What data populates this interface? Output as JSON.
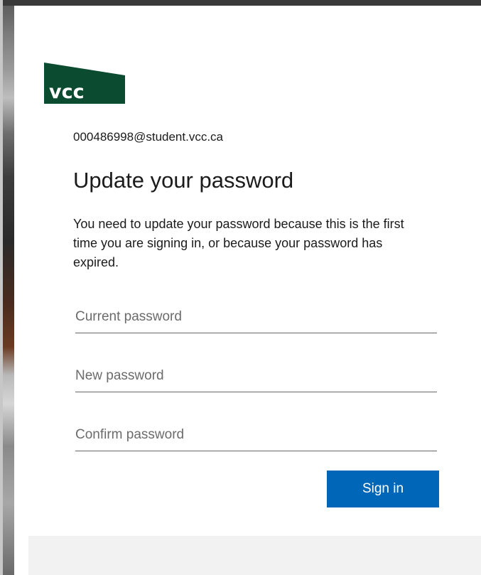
{
  "brand": {
    "logo_text": "vcc",
    "logo_color": "#0b4b30",
    "logo_text_color": "#ffffff"
  },
  "account": {
    "email": "000486998@student.vcc.ca"
  },
  "form": {
    "title": "Update your password",
    "description": "You need to update your password because this is the first time you are signing in, or because your password has expired.",
    "fields": {
      "current_password": {
        "placeholder": "Current password",
        "value": ""
      },
      "new_password": {
        "placeholder": "New password",
        "value": ""
      },
      "confirm_password": {
        "placeholder": "Confirm password",
        "value": ""
      }
    },
    "submit_label": "Sign in"
  },
  "colors": {
    "accent": "#0067b8",
    "text": "#1b1b1b",
    "input_border": "#666666",
    "footer_bg": "#f2f2f2"
  }
}
